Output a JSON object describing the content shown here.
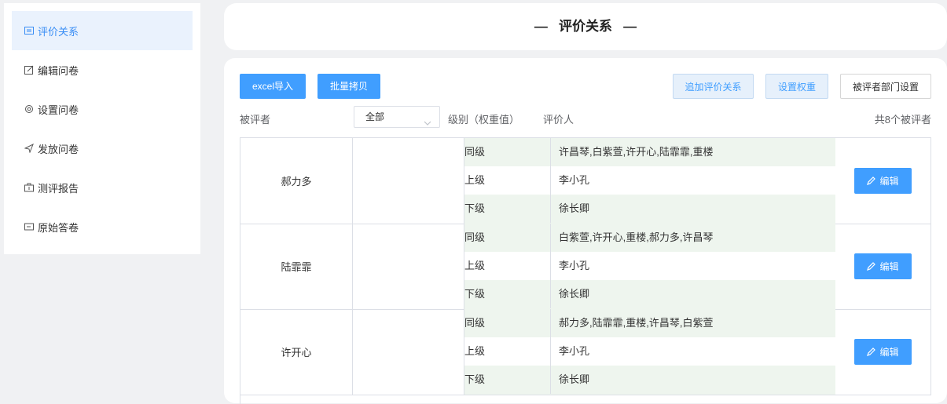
{
  "sidebar": {
    "items": [
      {
        "label": "评价关系",
        "icon": "table-icon"
      },
      {
        "label": "编辑问卷",
        "icon": "edit-icon"
      },
      {
        "label": "设置问卷",
        "icon": "gear-icon"
      },
      {
        "label": "发放问卷",
        "icon": "send-icon"
      },
      {
        "label": "测评报告",
        "icon": "briefcase-icon"
      },
      {
        "label": "原始答卷",
        "icon": "card-icon"
      }
    ],
    "active_index": 0
  },
  "header": {
    "title": "评价关系"
  },
  "toolbar": {
    "excel_import": "excel导入",
    "batch_copy": "批量拷贝",
    "add_relation": "追加评价关系",
    "set_weight": "设置权重",
    "dept_setting": "被评者部门设置"
  },
  "filter": {
    "evaluee_label": "被评者",
    "select_value": "全部",
    "level_label": "级别（权重值）",
    "evaluator_label": "评价人",
    "total": "共8个被评者"
  },
  "table": {
    "edit_label": "编辑",
    "rows": [
      {
        "name": "郝力多",
        "relations": [
          {
            "level": "同级",
            "evaluators": "许昌琴,白紫萱,许开心,陆霏霏,重楼"
          },
          {
            "level": "上级",
            "evaluators": "李小孔"
          },
          {
            "level": "下级",
            "evaluators": "徐长卿"
          }
        ]
      },
      {
        "name": "陆霏霏",
        "relations": [
          {
            "level": "同级",
            "evaluators": "白紫萱,许开心,重楼,郝力多,许昌琴"
          },
          {
            "level": "上级",
            "evaluators": "李小孔"
          },
          {
            "level": "下级",
            "evaluators": "徐长卿"
          }
        ]
      },
      {
        "name": "许开心",
        "relations": [
          {
            "level": "同级",
            "evaluators": "郝力多,陆霏霏,重楼,许昌琴,白紫萱"
          },
          {
            "level": "上级",
            "evaluators": "李小孔"
          },
          {
            "level": "下级",
            "evaluators": "徐长卿"
          }
        ]
      }
    ]
  },
  "colors": {
    "accent": "#409eff",
    "active_bg": "#eaf2fd",
    "row_alt": "#eef5ee"
  }
}
